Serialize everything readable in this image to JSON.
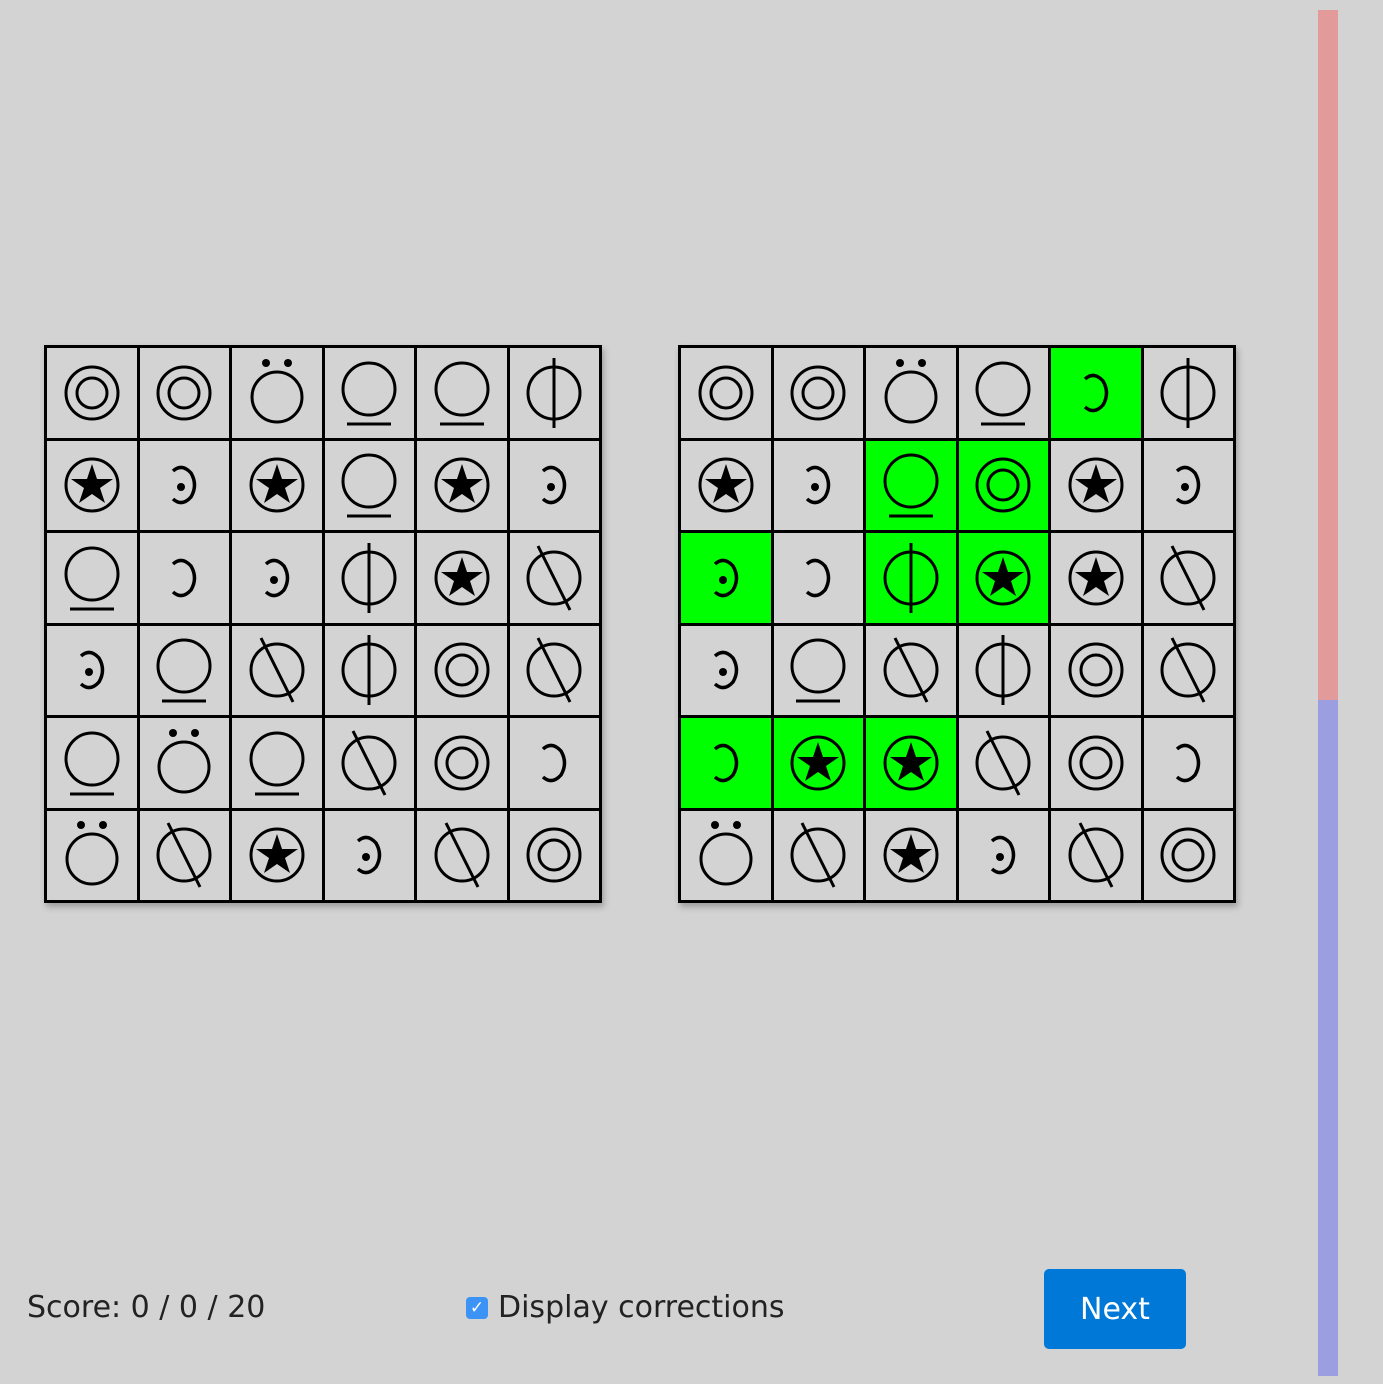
{
  "colors": {
    "highlight": "#00ff00",
    "cell": "#d3d3d3",
    "scroll_top": "#e29a9a",
    "scroll_bottom": "#9b9fe2",
    "button": "#0078d7"
  },
  "symbol_legend": {
    "A": "double-circle",
    "S": "star-circle",
    "D": "umlaut-circle",
    "U": "underlined-circle",
    "V": "vertical-bar-circle",
    "X": "slashed-circle",
    "C": "reversed-c",
    "E": "reversed-c-dot"
  },
  "left_grid": [
    [
      "A",
      "A",
      "D",
      "U",
      "U",
      "V"
    ],
    [
      "S",
      "E",
      "S",
      "U",
      "S",
      "E"
    ],
    [
      "U",
      "C",
      "E",
      "V",
      "S",
      "X"
    ],
    [
      "E",
      "U",
      "X",
      "V",
      "A",
      "X"
    ],
    [
      "U",
      "D",
      "U",
      "X",
      "A",
      "C"
    ],
    [
      "D",
      "X",
      "S",
      "E",
      "X",
      "A"
    ]
  ],
  "right_grid": [
    [
      "A",
      "A",
      "D",
      "U",
      "C",
      "V"
    ],
    [
      "S",
      "E",
      "U",
      "A",
      "S",
      "E"
    ],
    [
      "E",
      "C",
      "V",
      "S",
      "S",
      "X"
    ],
    [
      "E",
      "U",
      "X",
      "V",
      "A",
      "X"
    ],
    [
      "C",
      "S",
      "S",
      "X",
      "A",
      "C"
    ],
    [
      "D",
      "X",
      "S",
      "E",
      "X",
      "A"
    ]
  ],
  "right_highlighted": [
    [
      0,
      4
    ],
    [
      1,
      2
    ],
    [
      1,
      3
    ],
    [
      2,
      0
    ],
    [
      2,
      2
    ],
    [
      2,
      3
    ],
    [
      4,
      0
    ],
    [
      4,
      1
    ],
    [
      4,
      2
    ]
  ],
  "footer": {
    "score": "Score: 0 / 0 / 20",
    "corrections_label": "Display corrections",
    "corrections_checked": true,
    "next_label": "Next"
  }
}
